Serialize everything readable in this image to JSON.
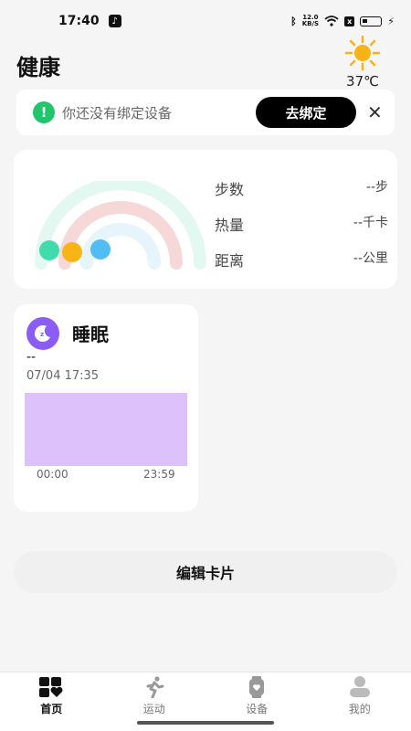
{
  "status_bar": {
    "time": "17:40",
    "net_speed_value": "12.0",
    "net_speed_unit": "KB/S",
    "sim_badge": "x"
  },
  "header": {
    "title": "健康",
    "weather": {
      "icon": "sun-icon",
      "temperature": "37℃"
    }
  },
  "bind_banner": {
    "icon": "alert-icon",
    "icon_glyph": "!",
    "text": "你还没有绑定设备",
    "button_label": "去绑定",
    "close_glyph": "✕"
  },
  "activity": {
    "stats": [
      {
        "label": "步数",
        "value": "--步"
      },
      {
        "label": "热量",
        "value": "--千卡"
      },
      {
        "label": "距离",
        "value": "--公里"
      }
    ],
    "colors": {
      "green": "#40dcae",
      "orange": "#f8b416",
      "blue": "#52bdf2",
      "pink": "#f7d8d8"
    }
  },
  "sleep": {
    "title": "睡眠",
    "value": "--",
    "datetime": "07/04 17:35",
    "axis_start": "00:00",
    "axis_end": "23:59",
    "chart_color": "#dcc1fb"
  },
  "edit_cards_label": "编辑卡片",
  "nav": [
    {
      "label": "首页",
      "icon": "home-icon",
      "active": true
    },
    {
      "label": "运动",
      "icon": "running-icon",
      "active": false
    },
    {
      "label": "设备",
      "icon": "watch-icon",
      "active": false
    },
    {
      "label": "我的",
      "icon": "profile-icon",
      "active": false
    }
  ]
}
